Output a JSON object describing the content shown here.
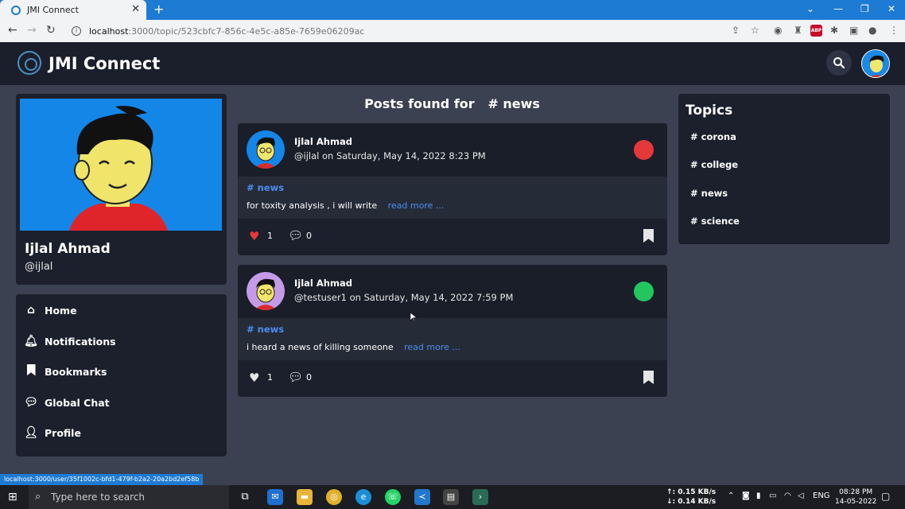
{
  "browser": {
    "tab_title": "JMI Connect",
    "url_host": "localhost",
    "url_path": ":3000/topic/523cbfc7-856c-4e5c-a85e-7659e06209ac",
    "status_url": "localhost:3000/user/35f1002c-bfd1-479f-b2a2-20a2bd2ef58b"
  },
  "app": {
    "brand": "JMI Connect"
  },
  "profile": {
    "name": "Ijlal Ahmad",
    "handle": "@ijlal"
  },
  "nav": [
    {
      "label": "Home",
      "icon": "home-icon"
    },
    {
      "label": "Notifications",
      "icon": "bell-icon"
    },
    {
      "label": "Bookmarks",
      "icon": "bookmark-icon"
    },
    {
      "label": "Global Chat",
      "icon": "chat-icon"
    },
    {
      "label": "Profile",
      "icon": "user-icon"
    }
  ],
  "center": {
    "title_prefix": "Posts found for",
    "title_topic": "# news"
  },
  "posts": [
    {
      "author": "Ijlal Ahmad",
      "meta": "@ijlal on Saturday, May 14, 2022 8:23 PM",
      "tag": "# news",
      "text": "for toxity analysis , i will write",
      "more": "read more ...",
      "likes": "1",
      "comments": "0",
      "status_color": "#e5383b",
      "liked": true
    },
    {
      "author": "Ijlal Ahmad",
      "meta": "@testuser1 on Saturday, May 14, 2022 7:59 PM",
      "tag": "# news",
      "text": "i heard a news of killing someone",
      "more": "read more ...",
      "likes": "1",
      "comments": "0",
      "status_color": "#22c55e",
      "liked": false
    }
  ],
  "topics": {
    "title": "Topics",
    "items": [
      "# corona",
      "# college",
      "# news",
      "# science"
    ]
  },
  "taskbar": {
    "search_placeholder": "Type here to search",
    "net_up": "↑: 0.15 KB/s",
    "net_down": "↓: 0.14 KB/s",
    "lang": "ENG",
    "time": "08:28 PM",
    "date": "14-05-2022"
  },
  "colors": {
    "accent_blue": "#4c8df0",
    "card_bg": "#1c202c",
    "page_bg": "#3b4151",
    "like_red": "#e5383b"
  }
}
